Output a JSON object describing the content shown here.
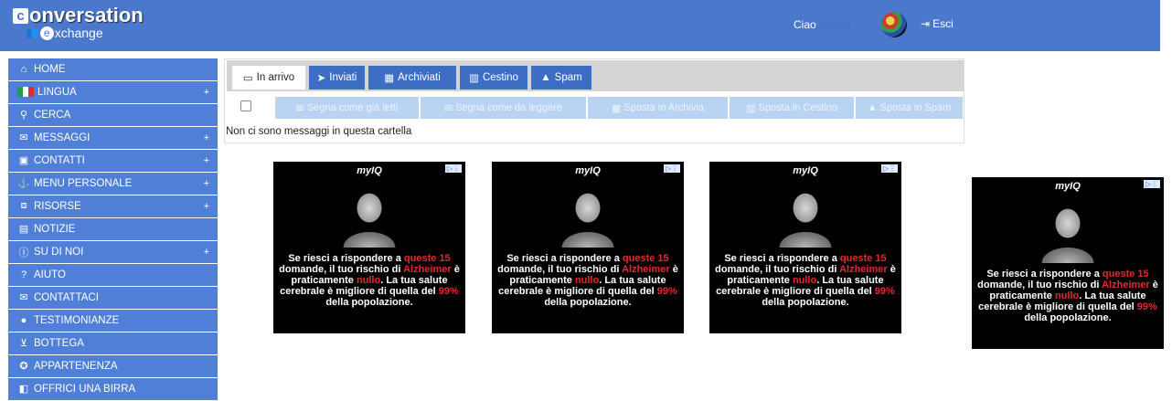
{
  "brand": {
    "letter1": "c",
    "rest1": "onversation",
    "letter2": "e",
    "rest2": "xchange"
  },
  "header": {
    "greeting": "Ciao",
    "username": "utente",
    "logout_label": "Esci"
  },
  "sidebar": {
    "items": [
      {
        "label": "HOME",
        "icon": "home-icon",
        "expandable": false
      },
      {
        "label": "LINGUA",
        "icon": "italy-flag-icon",
        "expandable": true
      },
      {
        "label": "CERCA",
        "icon": "search-icon",
        "expandable": false
      },
      {
        "label": "MESSAGGI",
        "icon": "envelope-icon",
        "expandable": true
      },
      {
        "label": "CONTATTI",
        "icon": "address-book-icon",
        "expandable": true
      },
      {
        "label": "MENU PERSONALE",
        "icon": "anchor-icon",
        "expandable": true
      },
      {
        "label": "RISORSE",
        "icon": "toolbox-icon",
        "expandable": true
      },
      {
        "label": "NOTIZIE",
        "icon": "newspaper-icon",
        "expandable": false
      },
      {
        "label": "SU DI NOI",
        "icon": "info-icon",
        "expandable": true
      },
      {
        "label": "AIUTO",
        "icon": "help-icon",
        "expandable": false
      },
      {
        "label": "CONTATTACI",
        "icon": "envelope-icon",
        "expandable": false
      },
      {
        "label": "TESTIMONIANZE",
        "icon": "comment-icon",
        "expandable": false
      },
      {
        "label": "BOTTEGA",
        "icon": "cart-icon",
        "expandable": false
      },
      {
        "label": "APPARTENENZA",
        "icon": "badge-icon",
        "expandable": false
      },
      {
        "label": "OFFRICI UNA BIRRA",
        "icon": "beer-icon",
        "expandable": false
      }
    ],
    "plus_symbol": "+"
  },
  "mail": {
    "tabs": [
      {
        "label": "In arrivo",
        "icon": "inbox-icon",
        "active": true
      },
      {
        "label": "Inviati",
        "icon": "send-icon",
        "active": false
      },
      {
        "label": "Archiviati",
        "icon": "archive-icon",
        "active": false
      },
      {
        "label": "Cestino",
        "icon": "trash-icon",
        "active": false
      },
      {
        "label": "Spam",
        "icon": "warning-icon",
        "active": false
      }
    ],
    "actions": [
      {
        "label": "Segna come già letti",
        "icon": "envelope-open-icon"
      },
      {
        "label": "Segna come da leggere",
        "icon": "envelope-icon"
      },
      {
        "label": "Sposta in Archivia",
        "icon": "archive-icon"
      },
      {
        "label": "Sposta in Cestino",
        "icon": "trash-icon"
      },
      {
        "label": "Sposta in Spam",
        "icon": "warning-icon"
      }
    ],
    "empty_message": "Non ci sono messaggi in questa cartella"
  },
  "ads": {
    "brand": "myIQ",
    "text_parts": [
      {
        "t": "Se riesci a rispondere a ",
        "red": false
      },
      {
        "t": "queste 15",
        "red": true
      },
      {
        "t": " domande, il tuo rischio di ",
        "red": false
      },
      {
        "t": "Alzheimer",
        "red": true
      },
      {
        "t": " è praticamente ",
        "red": false
      },
      {
        "t": "nullo",
        "red": true
      },
      {
        "t": ". La tua salute cerebrale è migliore di quella del ",
        "red": false
      },
      {
        "t": "99%",
        "red": true
      },
      {
        "t": " della popolazione.",
        "red": false
      }
    ],
    "count": 4
  },
  "colors": {
    "header": "#4a78cc",
    "sidebar": "#4f7fd6",
    "tab": "#3d6ec4",
    "action": "#b9d3f2",
    "ad_highlight": "#e8282d"
  }
}
